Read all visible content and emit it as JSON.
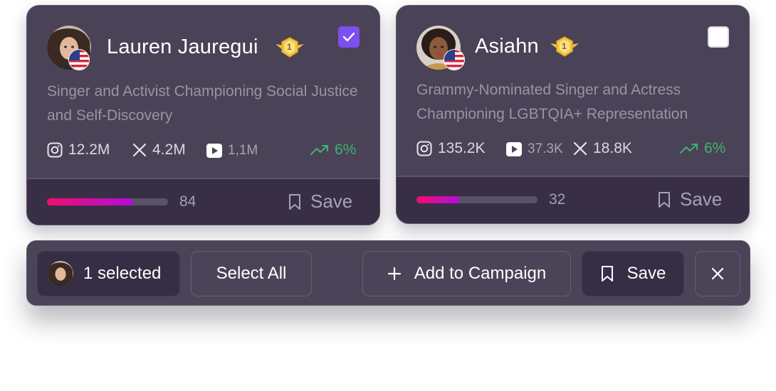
{
  "cards": [
    {
      "name": "Lauren Jauregui",
      "badge_number": "1",
      "selected": true,
      "bio": "Singer and Activist Championing Social Justice and Self-Discovery",
      "stats": {
        "instagram": "12.2M",
        "x": "4.2M",
        "youtube": "1,1M"
      },
      "growth": "6%",
      "score": "84",
      "score_fraction": 0.71,
      "save_label": "Save"
    },
    {
      "name": "Asiahn",
      "badge_number": "1",
      "selected": false,
      "bio": "Grammy-Nominated Singer and Actress Championing LGBTQIA+ Representation",
      "stats": {
        "instagram": "135.2K",
        "youtube": "37.3K",
        "x": "18.8K"
      },
      "growth": "6%",
      "score": "32",
      "score_fraction": 0.36,
      "save_label": "Save"
    }
  ],
  "selection_bar": {
    "selected_label": "1 selected",
    "select_all_label": "Select All",
    "add_to_campaign_label": "Add to Campaign",
    "save_label": "Save"
  },
  "colors": {
    "accent_check": "#7b4ff0",
    "growth": "#3fb36f",
    "progress_start": "#f20d6e",
    "progress_end": "#b10ed9"
  },
  "icons": [
    "instagram-icon",
    "x-icon",
    "youtube-icon",
    "trend-up-icon",
    "bookmark-icon",
    "plus-icon",
    "close-icon",
    "check-icon",
    "us-flag-icon",
    "gold-medal-icon"
  ]
}
